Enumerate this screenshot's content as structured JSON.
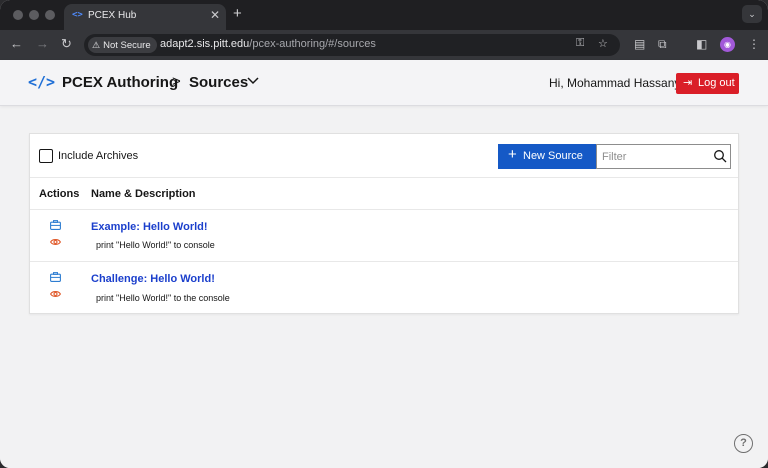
{
  "browser": {
    "tab_title": "PCEX Hub",
    "favicon": "<>",
    "security_label": "Not Secure",
    "url_host": "adapt2.sis.pitt.edu",
    "url_path": "/pcex-authoring/#/sources"
  },
  "header": {
    "brand": "PCEX Authoring",
    "separator": ">",
    "breadcrumb": "Sources",
    "greeting": "Hi, Mohammad Hassany",
    "logout_label": "Log out"
  },
  "toolbar": {
    "include_archives_label": "Include Archives",
    "include_archives_checked": false,
    "new_source_label": "New Source",
    "filter_placeholder": "Filter"
  },
  "table": {
    "columns": [
      "Actions",
      "Name & Description"
    ],
    "rows": [
      {
        "name": "Example: Hello World!",
        "description": "print \"Hello World!\" to console",
        "icons": [
          "archive-icon",
          "eye-icon"
        ]
      },
      {
        "name": "Challenge: Hello World!",
        "description": "print \"Hello World!\" to the console",
        "icons": [
          "archive-icon",
          "eye-icon"
        ]
      }
    ]
  },
  "colors": {
    "primary": "#1559c6",
    "danger": "#da1e28",
    "link": "#1b3fcc",
    "archive_icon": "#2e7dd1",
    "eye_icon": "#e0592a"
  }
}
